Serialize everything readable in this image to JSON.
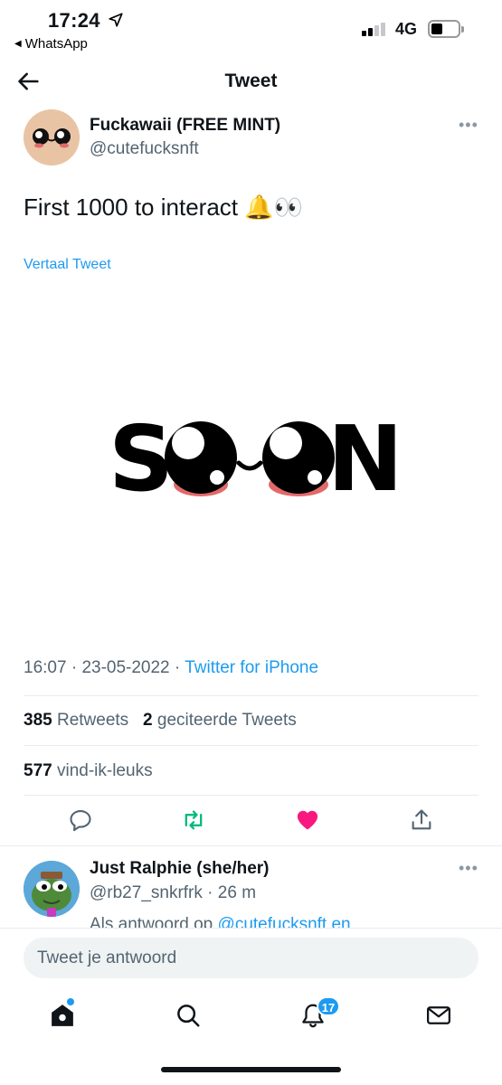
{
  "status_bar": {
    "time": "17:24",
    "back_app": "WhatsApp",
    "network": "4G"
  },
  "header": {
    "title": "Tweet"
  },
  "tweet": {
    "author_name": "Fuckawaii (FREE MINT)",
    "author_handle": "@cutefucksnft",
    "text": "First 1000 to interact 🔔👀",
    "translate_label": "Vertaal Tweet",
    "media_text": "SOON",
    "time": "16:07",
    "date": "23-05-2022",
    "client": "Twitter for iPhone",
    "retweets_count": "385",
    "retweets_label": "Retweets",
    "quotes_count": "2",
    "quotes_label": "geciteerde Tweets",
    "likes_count": "577",
    "likes_label": "vind-ik-leuks",
    "liked": true
  },
  "reply": {
    "author_name": "Just Ralphie (she/her)",
    "author_handle": "@rb27_snkrfrk",
    "time_ago": "26 m",
    "reply_prefix": "Als antwoord op",
    "reply_mention": "@cutefucksnft en"
  },
  "reply_input": {
    "placeholder": "Tweet je antwoord"
  },
  "bottom_nav": {
    "notifications_badge": "17"
  },
  "colors": {
    "accent": "#1d9bf0",
    "retweet": "#00ba7c",
    "like": "#f91880",
    "muted": "#536471",
    "media_cheek": "#e26a6a"
  },
  "icons": [
    "location-arrow-icon",
    "back-arrow-icon",
    "more-dots-icon",
    "reply-icon",
    "retweet-icon",
    "like-icon",
    "share-icon",
    "home-icon",
    "search-icon",
    "bell-icon",
    "mail-icon"
  ]
}
